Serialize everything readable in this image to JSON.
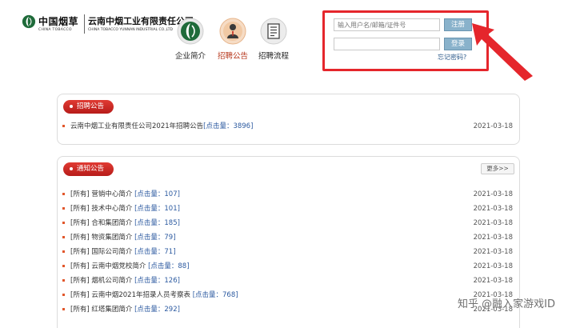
{
  "header": {
    "logo_cn": "中国烟草",
    "logo_en": "CHINA TOBACCO",
    "company_cn": "云南中烟工业有限责任公司",
    "company_en": "CHINA TOBACCO YUNNAN INDUSTRIAL CO.,LTD"
  },
  "nav": [
    {
      "label": "企业简介",
      "icon": "company-logo-icon",
      "active": false
    },
    {
      "label": "招聘公告",
      "icon": "person-icon",
      "active": true
    },
    {
      "label": "招聘流程",
      "icon": "document-list-icon",
      "active": false
    }
  ],
  "login": {
    "username_placeholder": "输入用户名/邮箱/证件号",
    "password_value": "",
    "register_label": "注册",
    "login_label": "登录",
    "forgot_label": "忘记密码?"
  },
  "recruit": {
    "title": "招聘公告",
    "items": [
      {
        "prefix": "",
        "text": "云南中烟工业有限责任公司2021年招聘公告",
        "clicks": "[点击量：3896]",
        "date": "2021-03-18"
      }
    ]
  },
  "notice": {
    "title": "通知公告",
    "more_label": "更多>>",
    "items": [
      {
        "prefix": "[所有]",
        "text": "营销中心简介",
        "clicks": "[点击量：107]",
        "date": "2021-03-18"
      },
      {
        "prefix": "[所有]",
        "text": "技术中心简介",
        "clicks": "[点击量：101]",
        "date": "2021-03-18"
      },
      {
        "prefix": "[所有]",
        "text": "合和集团简介",
        "clicks": "[点击量：185]",
        "date": "2021-03-18"
      },
      {
        "prefix": "[所有]",
        "text": "物资集团简介",
        "clicks": "[点击量：79]",
        "date": "2021-03-18"
      },
      {
        "prefix": "[所有]",
        "text": "国际公司简介",
        "clicks": "[点击量：71]",
        "date": "2021-03-18"
      },
      {
        "prefix": "[所有]",
        "text": "云南中烟党校简介",
        "clicks": "[点击量：88]",
        "date": "2021-03-18"
      },
      {
        "prefix": "[所有]",
        "text": "烟机公司简介",
        "clicks": "[点击量：126]",
        "date": "2021-03-18"
      },
      {
        "prefix": "[所有]",
        "text": "云南中烟2021年招录人员考察表",
        "clicks": "[点击量：768]",
        "date": "2021-03-18"
      },
      {
        "prefix": "[所有]",
        "text": "红塔集团简介",
        "clicks": "[点击量：292]",
        "date": "2021-03-18"
      }
    ]
  },
  "watermark": "知乎 @融入家游戏ID",
  "colors": {
    "accent_red": "#e5262c",
    "tag_red": "#c8231f",
    "button_blue": "#89b2cb",
    "link_blue": "#2c5aa0"
  }
}
